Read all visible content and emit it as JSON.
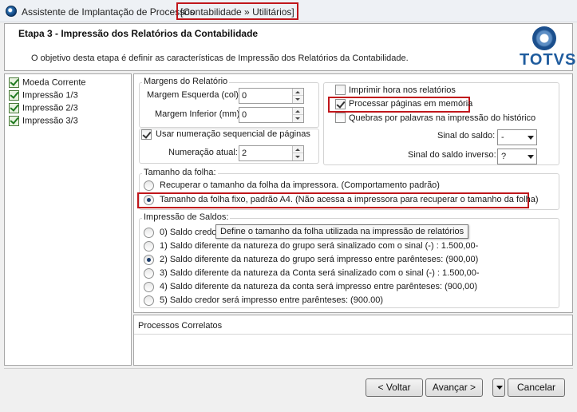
{
  "window": {
    "title": "Assistente de Implantação de Processos",
    "path": "[Contabilidade » Utilitários]"
  },
  "header": {
    "step_title": "Etapa 3 - Impressão dos Relatórios da Contabilidade",
    "description": "O objetivo desta etapa é definir as características de Impressão dos Relatórios da Contabilidade.",
    "logo_text": "TOTVS"
  },
  "steps": [
    {
      "label": "Moeda Corrente"
    },
    {
      "label": "Impressão 1/3"
    },
    {
      "label": "Impressão 2/3"
    },
    {
      "label": "Impressão 3/3"
    }
  ],
  "margins": {
    "legend": "Margens do Relatório",
    "left_label": "Margem Esquerda (col):",
    "left_value": "0",
    "bottom_label": "Margem Inferior (mm):",
    "bottom_value": "0",
    "seq_label": "Usar numeração sequencial de páginas",
    "seq_checked": true,
    "current_label": "Numeração atual:",
    "current_value": "2"
  },
  "options": {
    "print_time_label": "Imprimir hora nos relatórios",
    "print_time_checked": false,
    "process_mem_label": "Processar páginas em memória",
    "process_mem_checked": true,
    "word_break_label": "Quebras por palavras na impressão do histórico",
    "word_break_checked": false,
    "sign_label": "Sinal do saldo:",
    "sign_value": "-",
    "inverse_sign_label": "Sinal do saldo inverso:",
    "inverse_sign_value": "?"
  },
  "sheet_size": {
    "legend": "Tamanho da folha:",
    "options": [
      {
        "label": "Recuperar o tamanho da folha da impressora. (Comportamento padrão)",
        "selected": false
      },
      {
        "label": "Tamanho da folha fixo, padrão A4. (Não acessa a impressora para recuperar o tamanho da folha)",
        "selected": true
      }
    ]
  },
  "balances": {
    "legend": "Impressão de Saldos:",
    "options": [
      {
        "label": "0) Saldo credor",
        "selected": false
      },
      {
        "label": "1) Saldo diferente da natureza do grupo será sinalizado com o sinal (-) :  1.500,00-",
        "selected": false
      },
      {
        "label": "2) Saldo diferente da natureza do grupo será impresso entre parênteses:  (900,00)",
        "selected": true
      },
      {
        "label": "3) Saldo diferente da natureza da Conta será sinalizado com o sinal (-) :  1.500,00-",
        "selected": false
      },
      {
        "label": "4) Saldo diferente da natureza da conta será impresso entre parênteses:  (900,00)",
        "selected": false
      },
      {
        "label": "5) Saldo credor será impresso entre parênteses: (900.00)",
        "selected": false
      }
    ]
  },
  "tooltip": "Define o tamanho da folha utilizada na impressão de relatórios",
  "related": {
    "title": "Processos Correlatos"
  },
  "buttons": {
    "back": "< Voltar",
    "next": "Avançar >",
    "cancel": "Cancelar"
  },
  "colors": {
    "highlight": "#c0161b",
    "logo": "#1f5c9e"
  }
}
